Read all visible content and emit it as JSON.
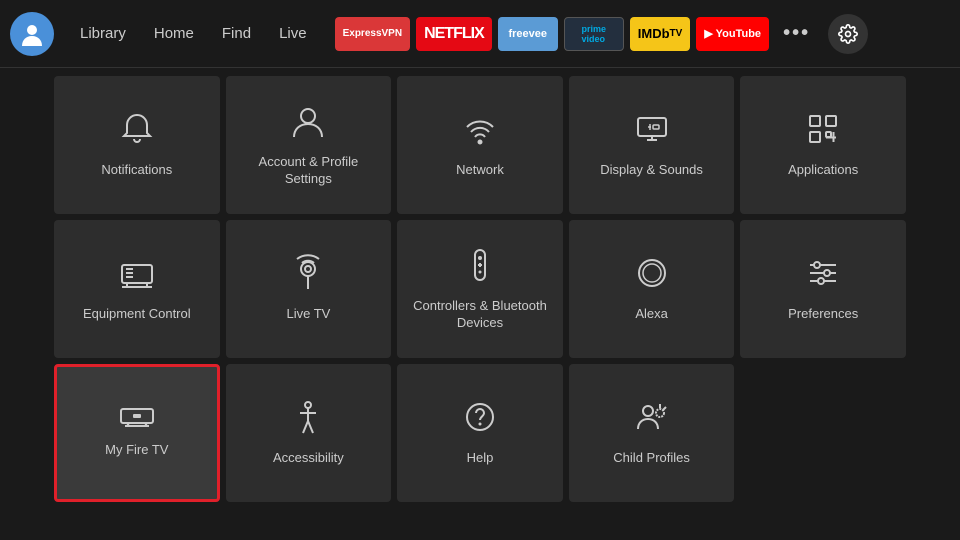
{
  "nav": {
    "links": [
      "Library",
      "Home",
      "Find",
      "Live"
    ],
    "apps": [
      {
        "label": "ExpressVPN",
        "class": "badge-expressvpn"
      },
      {
        "label": "NETFLIX",
        "class": "badge-netflix"
      },
      {
        "label": "freevee",
        "class": "badge-freevee"
      },
      {
        "label": "prime video",
        "class": "badge-prime"
      },
      {
        "label": "IMDbTV",
        "class": "badge-imdb"
      },
      {
        "label": "▶ YouTube",
        "class": "badge-youtube"
      }
    ],
    "more_label": "•••",
    "settings_label": "⚙"
  },
  "tiles": [
    {
      "id": "notifications",
      "label": "Notifications",
      "icon": "bell",
      "selected": false
    },
    {
      "id": "account",
      "label": "Account & Profile Settings",
      "icon": "person",
      "selected": false
    },
    {
      "id": "network",
      "label": "Network",
      "icon": "wifi",
      "selected": false
    },
    {
      "id": "display",
      "label": "Display & Sounds",
      "icon": "display",
      "selected": false
    },
    {
      "id": "applications",
      "label": "Applications",
      "icon": "apps",
      "selected": false
    },
    {
      "id": "equipment",
      "label": "Equipment Control",
      "icon": "tv",
      "selected": false
    },
    {
      "id": "livetv",
      "label": "Live TV",
      "icon": "antenna",
      "selected": false
    },
    {
      "id": "controllers",
      "label": "Controllers & Bluetooth Devices",
      "icon": "remote",
      "selected": false
    },
    {
      "id": "alexa",
      "label": "Alexa",
      "icon": "alexa",
      "selected": false
    },
    {
      "id": "preferences",
      "label": "Preferences",
      "icon": "sliders",
      "selected": false
    },
    {
      "id": "myfiretv",
      "label": "My Fire TV",
      "icon": "firetv",
      "selected": true
    },
    {
      "id": "accessibility",
      "label": "Accessibility",
      "icon": "accessibility",
      "selected": false
    },
    {
      "id": "help",
      "label": "Help",
      "icon": "help",
      "selected": false
    },
    {
      "id": "childprofiles",
      "label": "Child Profiles",
      "icon": "childprofiles",
      "selected": false
    }
  ]
}
